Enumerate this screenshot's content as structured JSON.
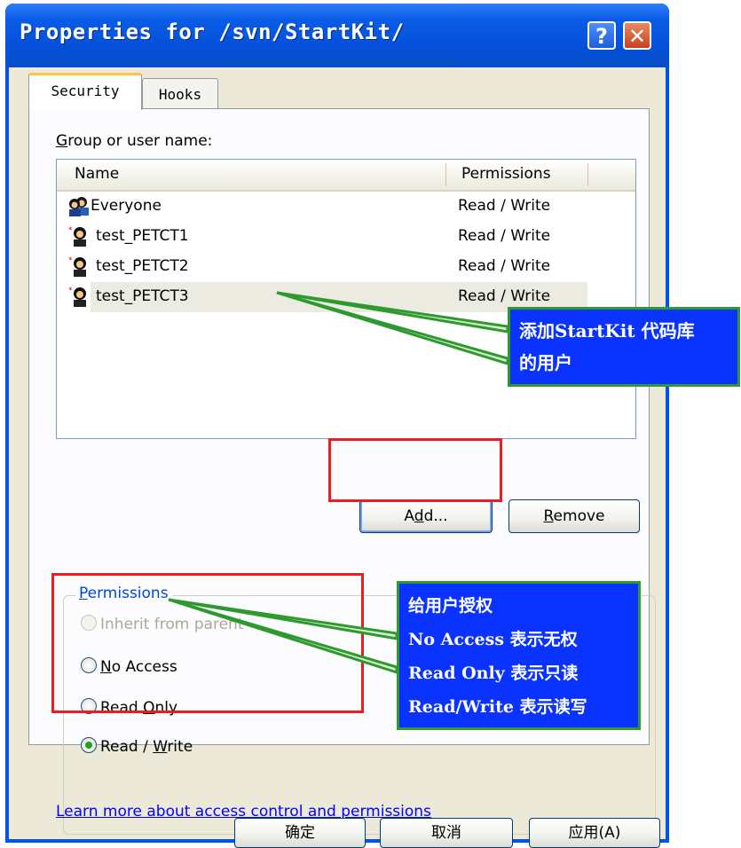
{
  "window": {
    "title": "Properties for /svn/StartKit/",
    "help_glyph": "?",
    "close_glyph": "✕"
  },
  "tabs": [
    {
      "label": "Security",
      "selected": true
    },
    {
      "label": "Hooks",
      "selected": false
    }
  ],
  "group_label": {
    "accel": "G",
    "rest": "roup or user name:"
  },
  "list": {
    "columns": [
      "Name",
      "Permissions"
    ],
    "rows": [
      {
        "name": "Everyone",
        "permission": "Read / Write",
        "icon": "group-icon",
        "selected": false
      },
      {
        "name": "test_PETCT1",
        "permission": "Read / Write",
        "icon": "user-icon",
        "selected": false
      },
      {
        "name": "test_PETCT2",
        "permission": "Read / Write",
        "icon": "user-icon",
        "selected": false
      },
      {
        "name": "test_PETCT3",
        "permission": "Read / Write",
        "icon": "user-icon",
        "selected": true
      }
    ]
  },
  "buttons": {
    "add": {
      "pre": "A",
      "accel": "d",
      "post": "d..."
    },
    "remove": {
      "accel": "R",
      "rest": "emove"
    },
    "ok": "确定",
    "cancel": "取消",
    "apply": "应用(A)"
  },
  "permissions": {
    "group_title": {
      "accel": "P",
      "rest": "ermissions"
    },
    "options": [
      {
        "pre": "Inherit from parent",
        "accel": "",
        "post": "",
        "checked": false,
        "disabled": true
      },
      {
        "pre": "",
        "accel": "N",
        "post": "o Access",
        "checked": false,
        "disabled": false
      },
      {
        "pre": "Read ",
        "accel": "O",
        "post": "nly",
        "checked": false,
        "disabled": false
      },
      {
        "pre": "Read / ",
        "accel": "W",
        "post": "rite",
        "checked": true,
        "disabled": false
      }
    ]
  },
  "learn_more_link": "Learn more about access control and permissions",
  "annotations": {
    "callout1": [
      "添加StartKit 代码库",
      "的用户"
    ],
    "callout2": [
      "给用户授权",
      "No Access 表示无权",
      "Read Only  表示只读",
      "Read/Write  表示读写"
    ]
  },
  "colors": {
    "titlebar": "#0054e3",
    "annotation_box": "#ec1c24",
    "callout_fill": "#0a33ff",
    "callout_border": "#2e9a2e"
  }
}
